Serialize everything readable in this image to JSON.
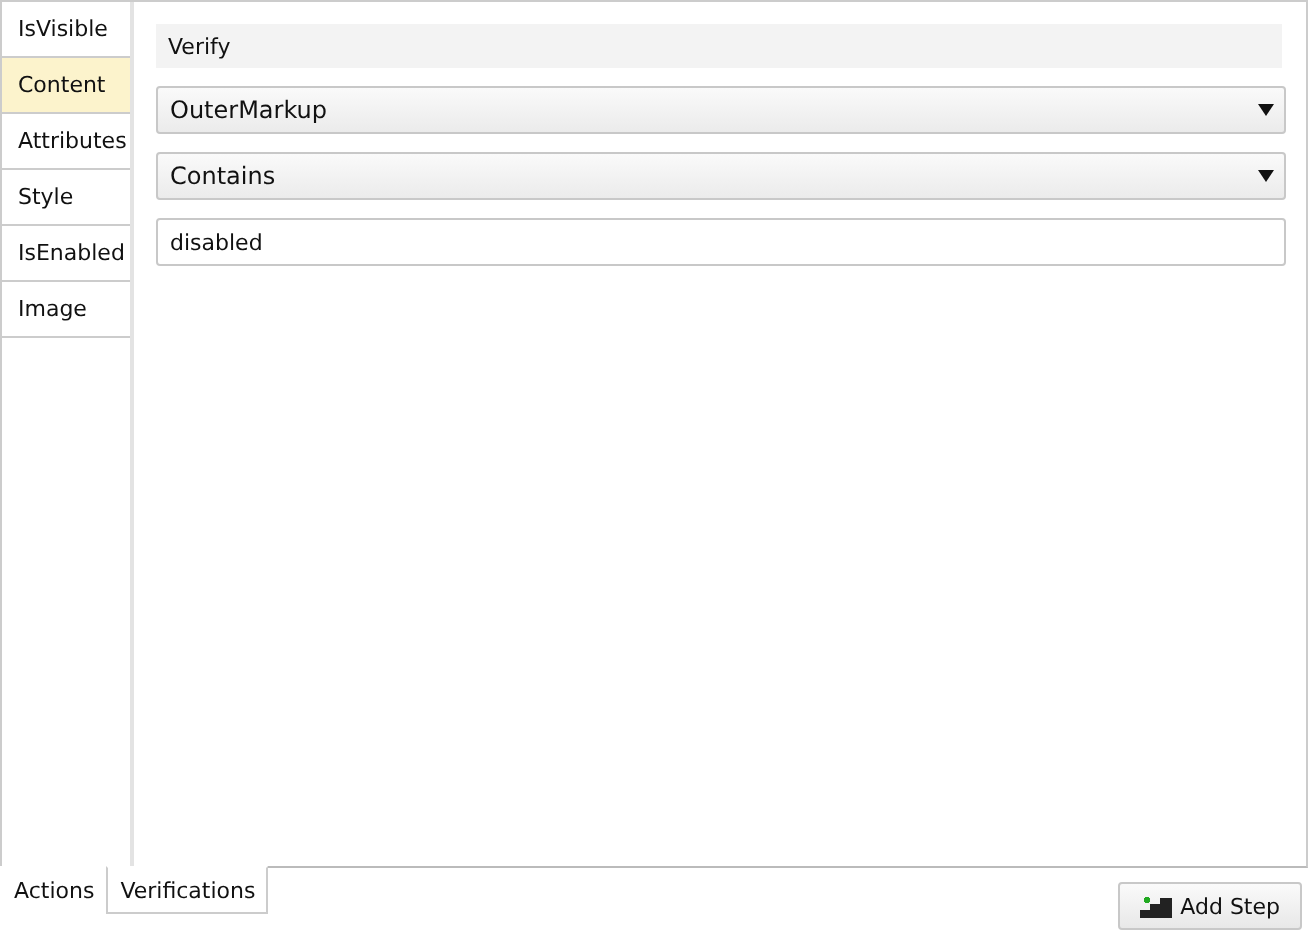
{
  "side_tabs": [
    {
      "label": "IsVisible",
      "selected": false
    },
    {
      "label": "Content",
      "selected": true
    },
    {
      "label": "Attributes",
      "selected": false
    },
    {
      "label": "Style",
      "selected": false
    },
    {
      "label": "IsEnabled",
      "selected": false
    },
    {
      "label": "Image",
      "selected": false
    }
  ],
  "header": "Verify",
  "dropdowns": [
    {
      "value": "OuterMarkup"
    },
    {
      "value": "Contains"
    }
  ],
  "text_field": {
    "value": "disabled"
  },
  "bottom_tabs": [
    {
      "label": "Actions",
      "selected": false
    },
    {
      "label": "Verifications",
      "selected": true
    }
  ],
  "add_step_button": "Add Step"
}
